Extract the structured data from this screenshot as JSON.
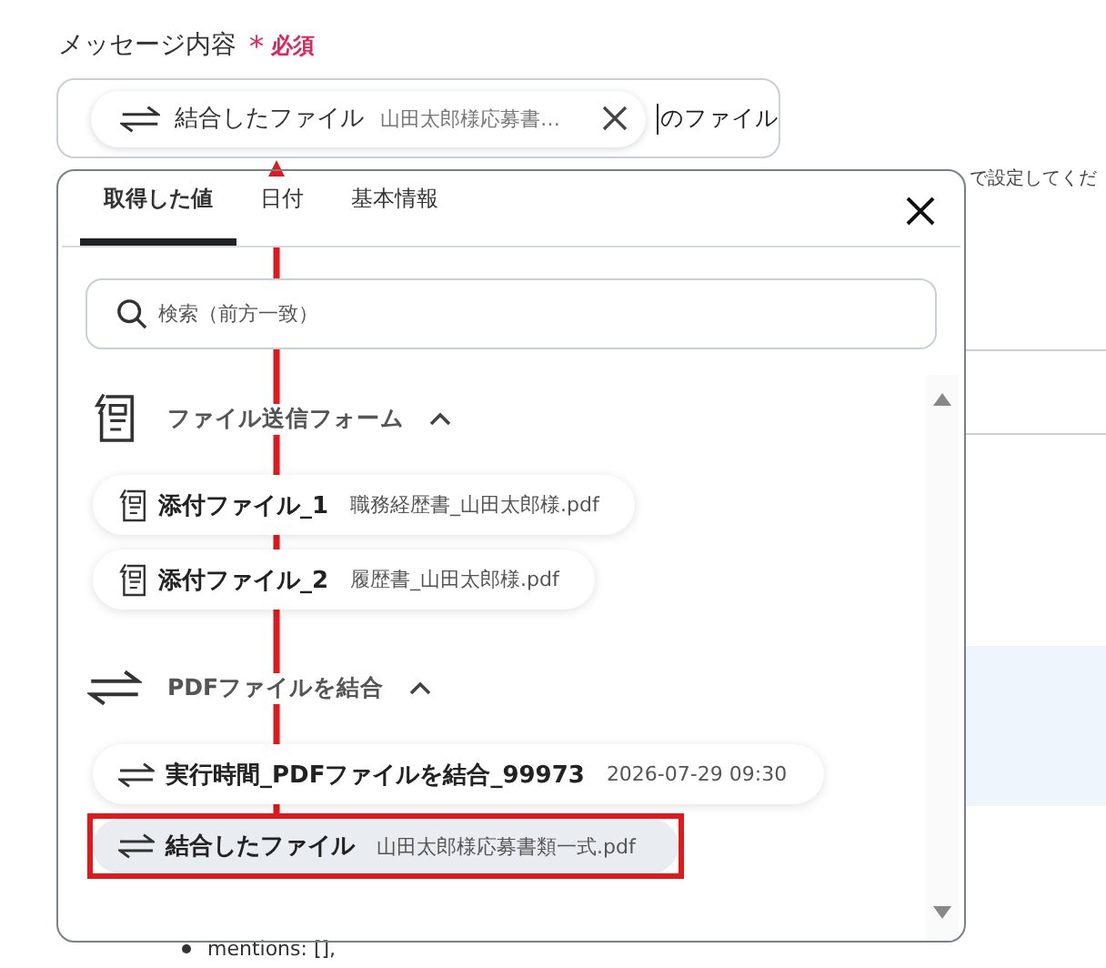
{
  "field": {
    "label": "メッセージ内容",
    "required_mark": "*",
    "required_label": "必須",
    "chip": {
      "kind": "transfer",
      "title": "結合したファイル",
      "value": "山田太郎様応募書…"
    },
    "text_after": "のファイル"
  },
  "background": {
    "hint": "で設定してくだ",
    "code_line": "mentions: [],"
  },
  "popup": {
    "tabs": [
      {
        "label": "取得した値",
        "selected": true
      },
      {
        "label": "日付",
        "selected": false
      },
      {
        "label": "基本情報",
        "selected": false
      }
    ],
    "search": {
      "placeholder": "検索（前方一致）"
    },
    "groups": [
      {
        "kind": "form",
        "title": "ファイル送信フォーム",
        "expanded": true,
        "items": [
          {
            "label": "添付ファイル_1",
            "value": "職務経歴書_山田太郎様.pdf",
            "selected": false
          },
          {
            "label": "添付ファイル_2",
            "value": "履歴書_山田太郎様.pdf",
            "selected": false
          }
        ]
      },
      {
        "kind": "transfer",
        "title": "PDFファイルを結合",
        "expanded": true,
        "items": [
          {
            "label": "実行時間_PDFファイルを結合_99973",
            "value": "2026-07-29 09:30",
            "selected": false
          },
          {
            "label": "結合したファイル",
            "value": "山田太郎様応募書類一式.pdf",
            "selected": true
          }
        ]
      }
    ]
  }
}
